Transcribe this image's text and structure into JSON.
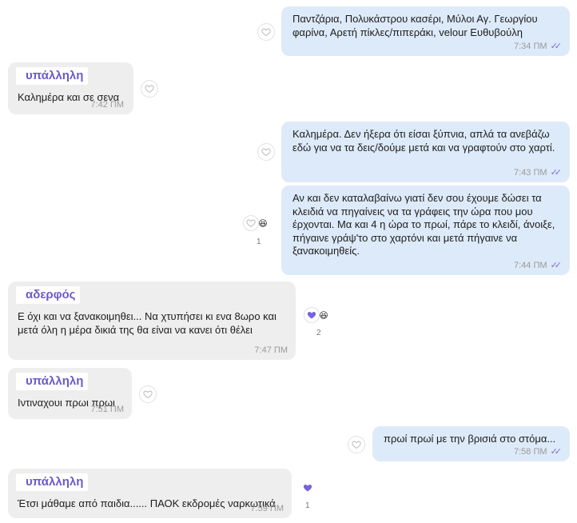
{
  "messages": [
    {
      "text": "Παντζάρια, Πολυκάστρου κασέρι, Μύλοι Αγ. Γεωργίου φαρίνα, Αρετή πίκλες/πιπεράκι, velour Ευθυβούλη",
      "time": "7:34 ΠΜ"
    },
    {
      "sender": "υπάλληλη",
      "text": "Καλημέρα και σε σενα",
      "time": "7:42 ΠΜ"
    },
    {
      "text": "Καλημέρα. Δεν ήξερα ότι είσαι ξύπνια, απλά τα ανεβάζω εδώ για να τα δεις/δούμε μετά και να γραφτούν στο χαρτί.",
      "time": "7:43 ΠΜ"
    },
    {
      "text": "Αν και δεν καταλαβαίνω γιατί δεν σου έχουμε δώσει τα κλειδιά να πηγαίνεις να τα γράφεις την ώρα που μου έρχονται. Μα και 4 η ώρα το πρωί, πάρε το κλειδί, άνοιξε, πήγαινε γράψ'το στο χαρτόνι και μετά πήγαινε να ξανακοιμηθείς.",
      "time": "7:44 ΠΜ",
      "reaction_count": "1"
    },
    {
      "sender": "αδερφός",
      "text": "Ε όχι και να ξανακοιμηθει... Να χτυπήσει κι ενα 8ωρο και μετά όλη η μέρα δικιά της θα είναι να κανει ότι θέλει",
      "time": "7:47 ΠΜ",
      "reaction_count": "2"
    },
    {
      "sender": "υπάλληλη",
      "text": "Ιντιναχουι πρωι πρωι",
      "time": "7:51 ΠΜ"
    },
    {
      "text": "πρωί πρωί με την βρισιά στο στόμα...",
      "time": "7:58 ΠΜ"
    },
    {
      "sender": "υπάλληλη",
      "text": "Έτσι μάθαμε από παιδια...... ΠΑΟΚ εκδρομές ναρκωτικά",
      "time": "7:59 ΠΜ",
      "reaction_count": "1"
    }
  ],
  "icons": {
    "heart_outline": "heart-outline-icon",
    "heart_filled": "heart-filled-icon",
    "laugh": "laughing-emoji-icon",
    "read_ticks": "double-check-icon"
  },
  "colors": {
    "outgoing_bubble": "#ddeaf9",
    "incoming_bubble": "#eeeeee",
    "accent": "#6a5acd",
    "ticks": "#7b6fd6"
  }
}
